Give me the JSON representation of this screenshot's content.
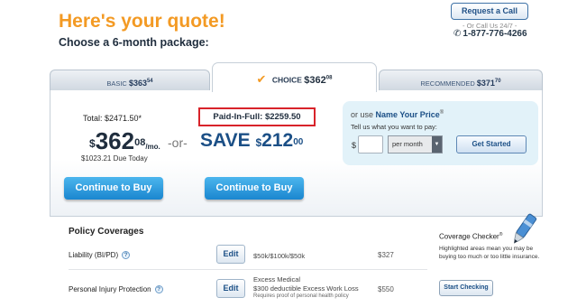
{
  "header": {
    "title": "Here's your quote!",
    "subtitle": "Choose a 6-month package:"
  },
  "contact": {
    "request_call_label": "Request a Call",
    "call_note": "- Or Call Us 24/7 -",
    "phone": "1-877-776-4266"
  },
  "tabs": {
    "basic": {
      "label": "BASIC",
      "price": "$363",
      "cents": "54"
    },
    "choice": {
      "label": "CHOICE",
      "price": "$362",
      "cents": "08"
    },
    "recommended": {
      "label": "RECOMMENDED",
      "price": "$371",
      "cents": "70"
    }
  },
  "quote": {
    "total": "Total: $2471.50*",
    "monthly_dollar": "$",
    "monthly_whole": "362",
    "monthly_cents": "08",
    "per_month": "/mo.",
    "due_today": "$1023.21 Due Today",
    "or_text": "-or-",
    "paid_in_full": "Paid-In-Full: $2259.50",
    "save_prefix": "SAVE",
    "save_dollar": "$",
    "save_whole": "212",
    "save_cents": "00",
    "buy_label": "Continue to Buy",
    "buy_label_2": "Continue to Buy"
  },
  "name_your_price": {
    "prefix": "or use",
    "title": "Name Your Price",
    "reg": "®",
    "description": "Tell us what you want to pay:",
    "dollar_sign": "$",
    "amount_value": "",
    "period_selected": "per month",
    "get_started_label": "Get Started"
  },
  "coverages": {
    "title": "Policy Coverages",
    "edit_label": "Edit",
    "rows": [
      {
        "label": "Liability (BI/PD)",
        "limits": "$50k/$100k/$50k",
        "amount": "$327"
      },
      {
        "label": "Personal Injury Protection",
        "limits_1": "Excess Medical",
        "limits_2": "$300 deductible Excess Work Loss",
        "limits_note": "Requires proof of personal health policy",
        "amount": "$550"
      }
    ]
  },
  "checker": {
    "title": "Coverage Checker",
    "reg": "®",
    "description": "Highlighted areas mean you may be buying too much or too little insurance.",
    "button_label": "Start Checking"
  },
  "colors": {
    "accent_orange": "#f39a24",
    "brand_blue": "#1b4f86",
    "highlight_red": "#d8232a",
    "buy_blue": "#1a86cf",
    "nyp_bg": "#e2f2f9"
  }
}
